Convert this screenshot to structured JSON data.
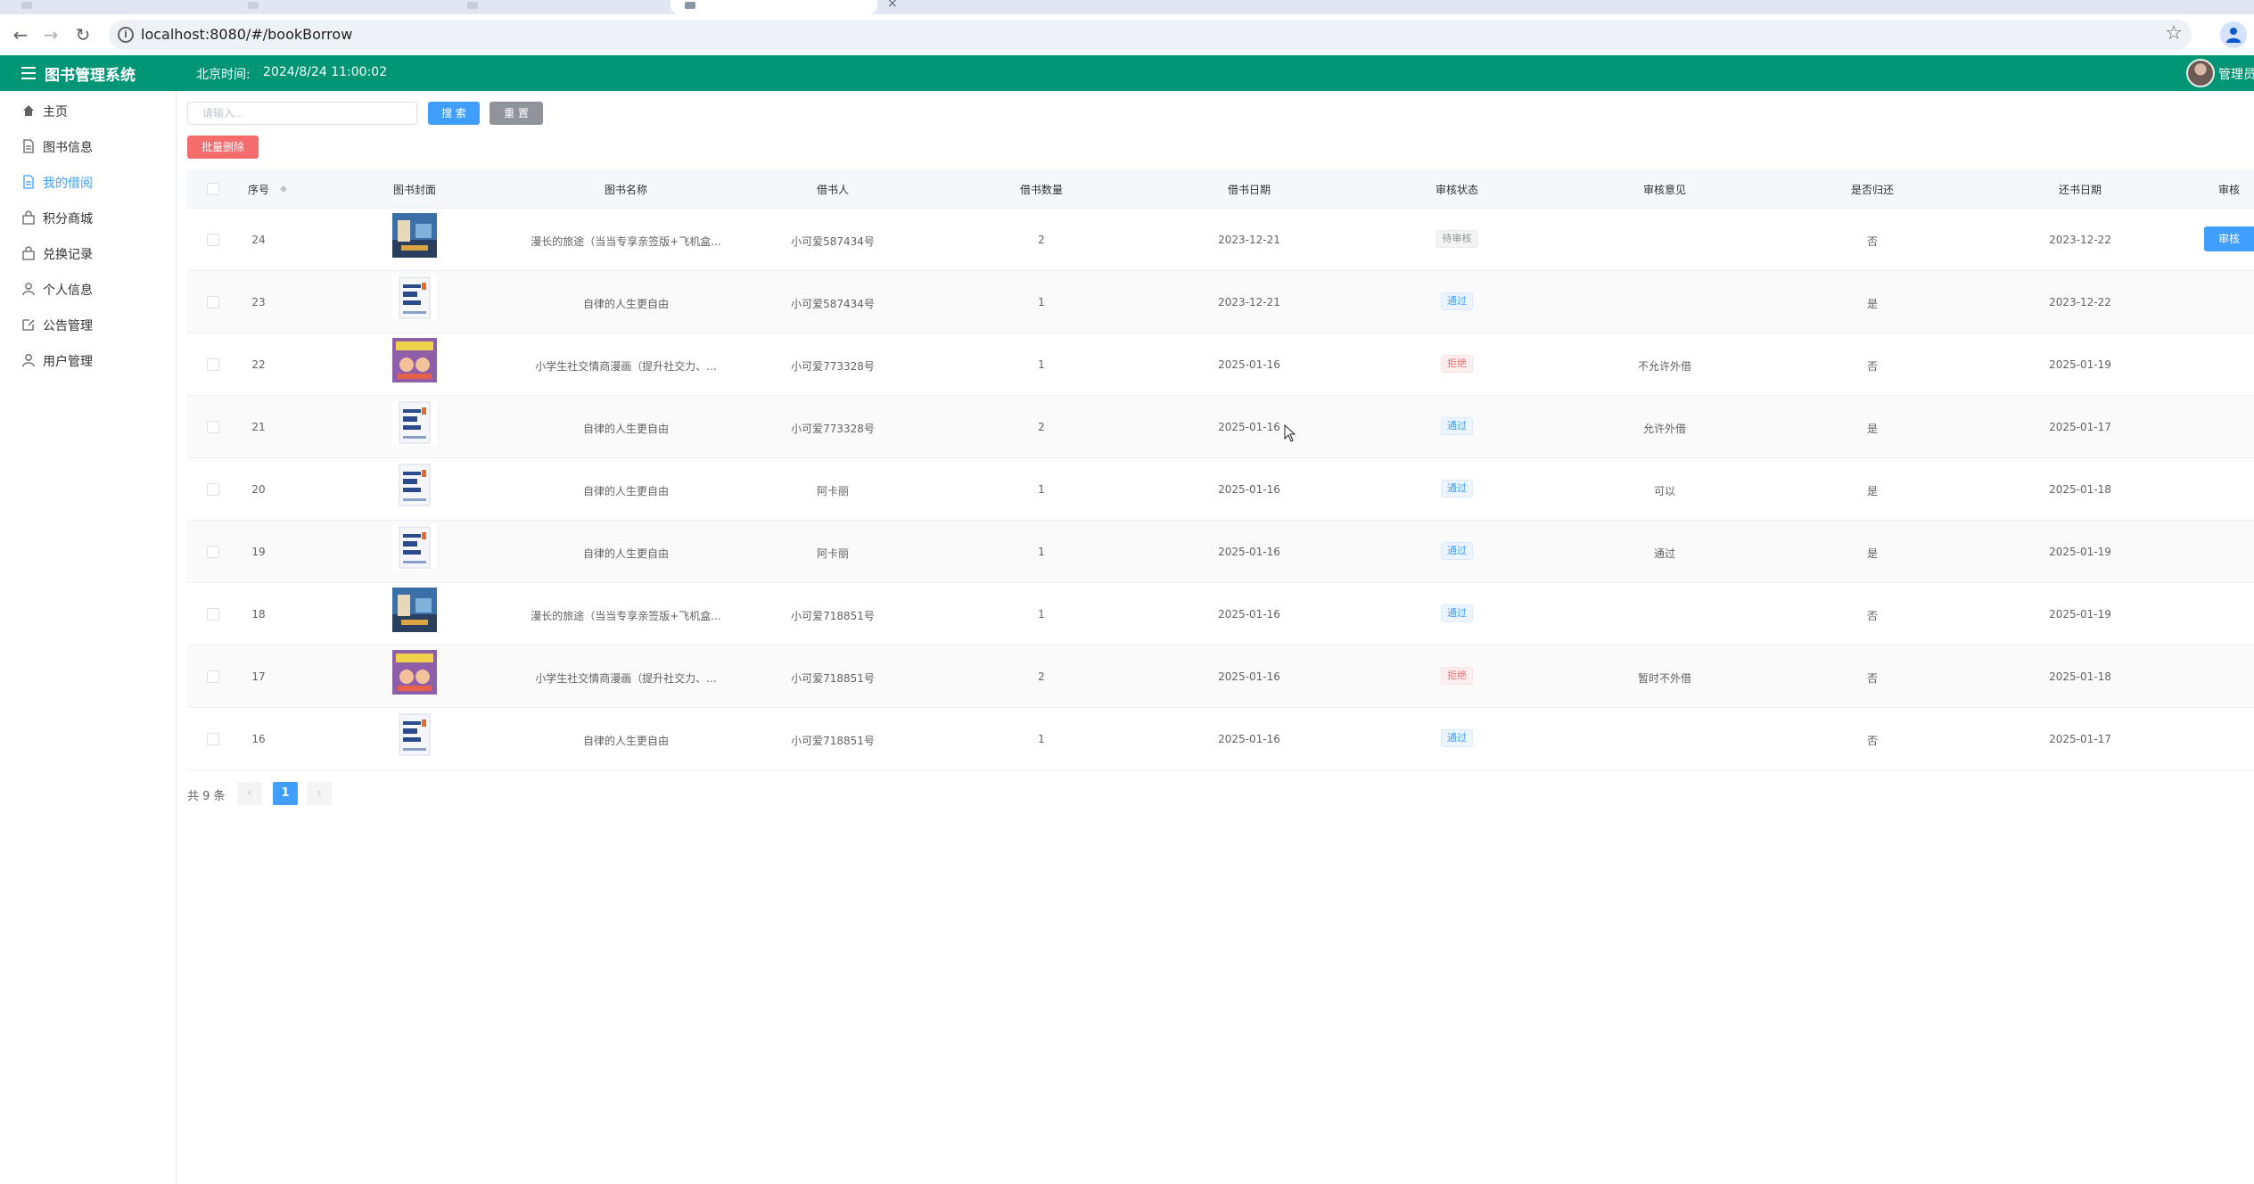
{
  "browser": {
    "url": "localhost:8080/#/bookBorrow"
  },
  "header": {
    "title": "图书管理系统",
    "clock_label": "北京时间:",
    "clock_value": "2024/8/24 11:00:02",
    "user_name": "管理员"
  },
  "sidebar": {
    "items": [
      {
        "label": "主页",
        "icon": "home-icon"
      },
      {
        "label": "图书信息",
        "icon": "document-icon"
      },
      {
        "label": "我的借阅",
        "icon": "document-icon"
      },
      {
        "label": "积分商城",
        "icon": "bag-icon"
      },
      {
        "label": "兑换记录",
        "icon": "bag-icon"
      },
      {
        "label": "个人信息",
        "icon": "user-icon"
      },
      {
        "label": "公告管理",
        "icon": "edit-icon"
      },
      {
        "label": "用户管理",
        "icon": "user-icon"
      }
    ],
    "active_index": 2
  },
  "search": {
    "placeholder": "请输入...",
    "search_label": "搜 索",
    "reset_label": "重 置",
    "batch_delete_label": "批量删除"
  },
  "table": {
    "headers": {
      "id": "序号",
      "cover": "图书封面",
      "name": "图书名称",
      "borrower": "借书人",
      "quantity": "借书数量",
      "borrow_date": "借书日期",
      "status": "审核状态",
      "opinion": "审核意见",
      "returned": "是否归还",
      "return_date": "还书日期",
      "action": "审核"
    },
    "rows": [
      {
        "id": "24",
        "cover": "travel",
        "name": "漫长的旅途（当当专享亲签版+飞机盒...",
        "borrower": "小可爱587434号",
        "quantity": "2",
        "borrow_date": "2023-12-21",
        "status": "待审核",
        "status_type": "info",
        "opinion": "",
        "returned": "否",
        "return_date": "2023-12-22",
        "action": "审核"
      },
      {
        "id": "23",
        "cover": "selfdisc",
        "name": "自律的人生更自由",
        "borrower": "小可爱587434号",
        "quantity": "1",
        "borrow_date": "2023-12-21",
        "status": "通过",
        "status_type": "success",
        "opinion": "",
        "returned": "是",
        "return_date": "2023-12-22",
        "action": ""
      },
      {
        "id": "22",
        "cover": "social",
        "name": "小学生社交情商漫画（提升社交力、...",
        "borrower": "小可爱773328号",
        "quantity": "1",
        "borrow_date": "2025-01-16",
        "status": "拒绝",
        "status_type": "danger",
        "opinion": "不允许外借",
        "returned": "否",
        "return_date": "2025-01-19",
        "action": ""
      },
      {
        "id": "21",
        "cover": "selfdisc",
        "name": "自律的人生更自由",
        "borrower": "小可爱773328号",
        "quantity": "2",
        "borrow_date": "2025-01-16",
        "status": "通过",
        "status_type": "success",
        "opinion": "允许外借",
        "returned": "是",
        "return_date": "2025-01-17",
        "action": ""
      },
      {
        "id": "20",
        "cover": "selfdisc",
        "name": "自律的人生更自由",
        "borrower": "阿卡丽",
        "quantity": "1",
        "borrow_date": "2025-01-16",
        "status": "通过",
        "status_type": "success",
        "opinion": "可以",
        "returned": "是",
        "return_date": "2025-01-18",
        "action": ""
      },
      {
        "id": "19",
        "cover": "selfdisc",
        "name": "自律的人生更自由",
        "borrower": "阿卡丽",
        "quantity": "1",
        "borrow_date": "2025-01-16",
        "status": "通过",
        "status_type": "success",
        "opinion": "通过",
        "returned": "是",
        "return_date": "2025-01-19",
        "action": ""
      },
      {
        "id": "18",
        "cover": "travel",
        "name": "漫长的旅途（当当专享亲签版+飞机盒...",
        "borrower": "小可爱718851号",
        "quantity": "1",
        "borrow_date": "2025-01-16",
        "status": "通过",
        "status_type": "success",
        "opinion": "",
        "returned": "否",
        "return_date": "2025-01-19",
        "action": ""
      },
      {
        "id": "17",
        "cover": "social",
        "name": "小学生社交情商漫画（提升社交力、...",
        "borrower": "小可爱718851号",
        "quantity": "2",
        "borrow_date": "2025-01-16",
        "status": "拒绝",
        "status_type": "danger",
        "opinion": "暂时不外借",
        "returned": "否",
        "return_date": "2025-01-18",
        "action": ""
      },
      {
        "id": "16",
        "cover": "selfdisc",
        "name": "自律的人生更自由",
        "borrower": "小可爱718851号",
        "quantity": "1",
        "borrow_date": "2025-01-16",
        "status": "通过",
        "status_type": "success",
        "opinion": "",
        "returned": "否",
        "return_date": "2025-01-17",
        "action": ""
      }
    ]
  },
  "pagination": {
    "total_label": "共 9 条",
    "current_page": "1",
    "prev": "‹",
    "next": "›"
  },
  "colors": {
    "header_bg": "#009574",
    "primary": "#409eff",
    "danger": "#f56c6c",
    "neutral": "#909399"
  }
}
